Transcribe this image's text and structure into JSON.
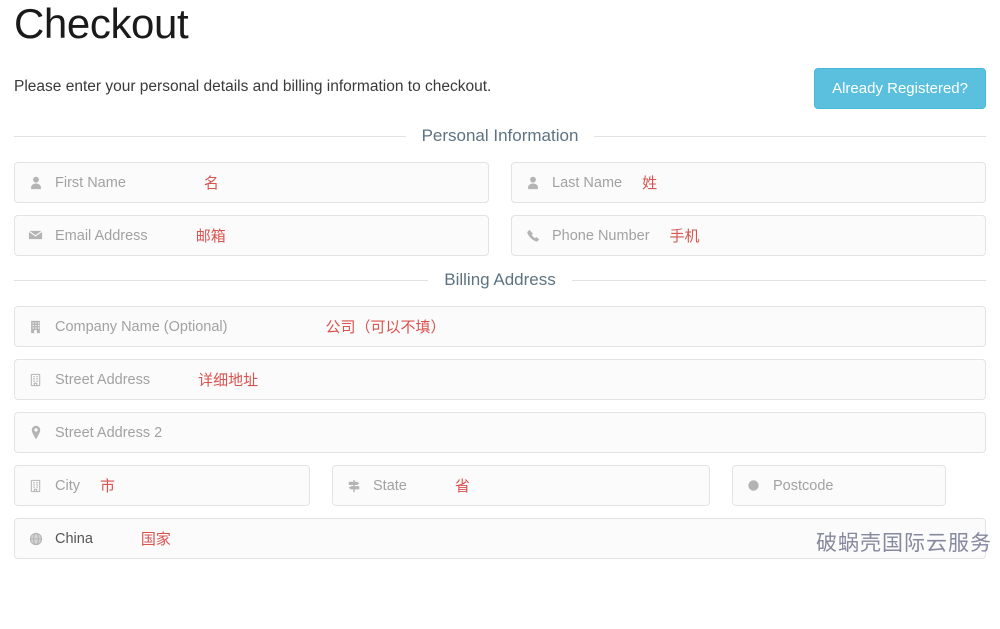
{
  "header": {
    "title": "Checkout",
    "subtitle": "Please enter your personal details and billing information to checkout.",
    "registered_button": "Already Registered?"
  },
  "sections": {
    "personal": "Personal Information",
    "billing": "Billing Address"
  },
  "fields": {
    "first_name": {
      "placeholder": "First Name",
      "icon": "user-icon",
      "annotation": "名"
    },
    "last_name": {
      "placeholder": "Last Name",
      "icon": "user-icon",
      "annotation": "姓"
    },
    "email": {
      "placeholder": "Email Address",
      "icon": "envelope-icon",
      "annotation": "邮箱"
    },
    "phone": {
      "placeholder": "Phone Number",
      "icon": "phone-icon",
      "annotation": "手机"
    },
    "company": {
      "placeholder": "Company Name (Optional)",
      "icon": "building-icon",
      "annotation": "公司（可以不填）"
    },
    "street1": {
      "placeholder": "Street Address",
      "icon": "building-alt-icon",
      "annotation": "详细地址"
    },
    "street2": {
      "placeholder": "Street Address 2",
      "icon": "map-marker-icon",
      "annotation": ""
    },
    "city": {
      "placeholder": "City",
      "icon": "building-alt-icon",
      "annotation": "市"
    },
    "state": {
      "placeholder": "State",
      "icon": "signpost-icon",
      "annotation": "省"
    },
    "postcode": {
      "placeholder": "Postcode",
      "icon": "circle-icon",
      "annotation": ""
    },
    "country": {
      "value": "China",
      "icon": "globe-icon",
      "annotation": "国家"
    }
  },
  "watermark": "破蜗壳国际云服务",
  "colors": {
    "accent_button": "#5bc0de",
    "annotation": "#d9534f",
    "legend_text": "#5d7382",
    "field_border": "#e3e3e3",
    "field_bg": "#fbfbfb"
  }
}
